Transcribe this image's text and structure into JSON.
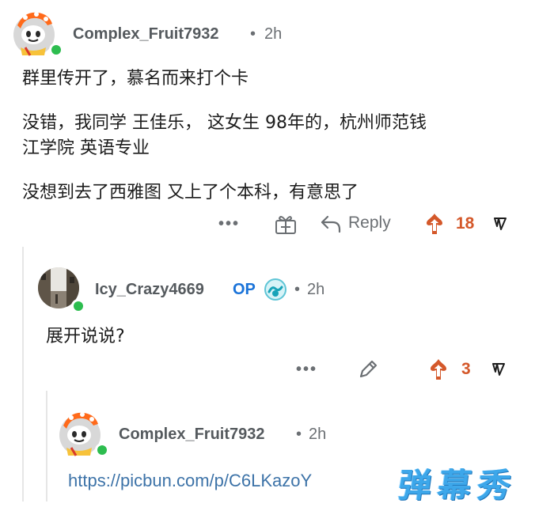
{
  "comments": [
    {
      "username": "Complex_Fruit7932",
      "separator": "•",
      "time": "2h",
      "lines": [
        "群里传开了，慕名而来打个卡",
        "没错，我同学 王佳乐， 这女生 98年的，杭州师范钱",
        "江学院 英语专业",
        "没想到去了西雅图 又上了个本科，有意思了"
      ],
      "actions": {
        "more": "•••",
        "reply": "Reply",
        "score": "18"
      }
    },
    {
      "username": "Icy_Crazy4669",
      "op_badge": "OP",
      "separator": "•",
      "time": "2h",
      "lines": [
        "展开说说?"
      ],
      "actions": {
        "more": "•••",
        "score": "3"
      }
    },
    {
      "username": "Complex_Fruit7932",
      "separator": "•",
      "time": "2h",
      "link": "https://picbun.com/p/C6LKazoY"
    }
  ],
  "watermark": "弹幕秀",
  "colors": {
    "username": "#555a5e",
    "meta": "#6b6f73",
    "op": "#1a73d9",
    "score": "#d4582a",
    "link": "#3d73a8",
    "online": "#2dbd4f",
    "watermark": "#3da7ea"
  },
  "icons": [
    "snoo-avatar",
    "photo-avatar",
    "online-dot",
    "more-icon",
    "award-icon",
    "reply-icon",
    "upvote-icon",
    "downvote-icon",
    "edit-icon",
    "achievement-badge-icon"
  ]
}
